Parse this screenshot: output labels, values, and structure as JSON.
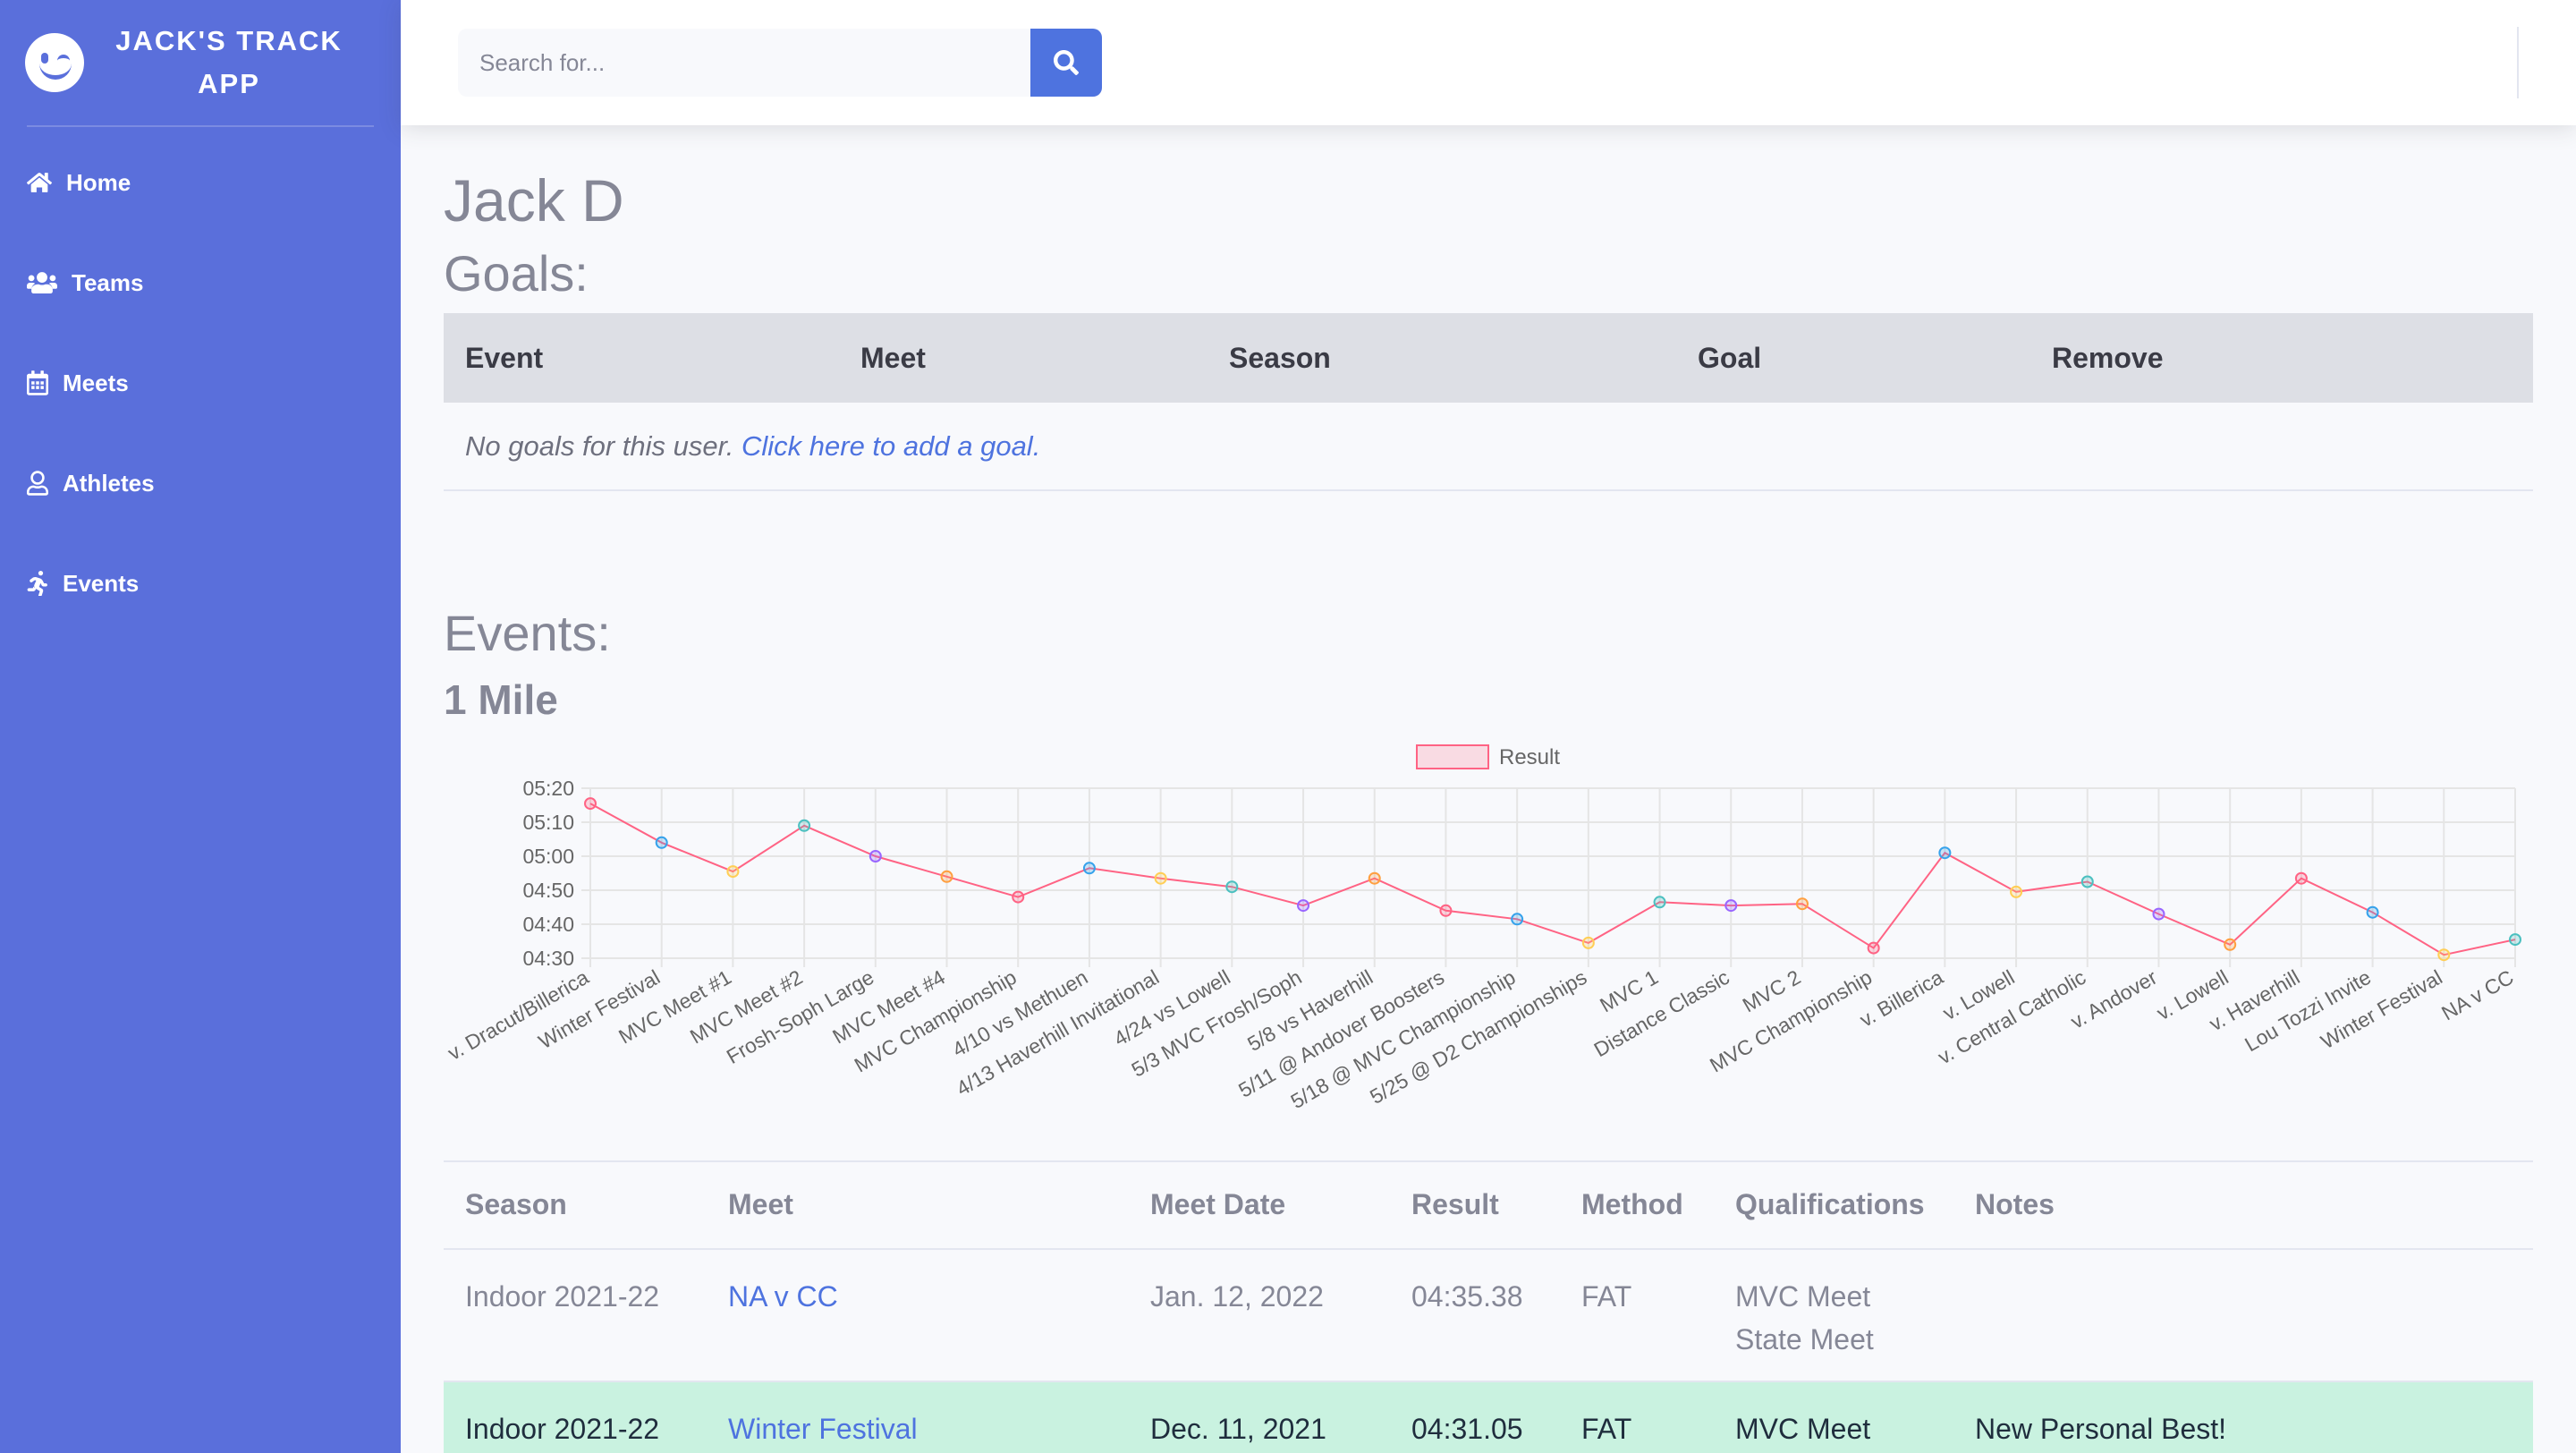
{
  "app": {
    "title": "JACK'S TRACK APP"
  },
  "sidebar": {
    "items": [
      {
        "label": "Home",
        "icon": "home-icon"
      },
      {
        "label": "Teams",
        "icon": "users-icon"
      },
      {
        "label": "Meets",
        "icon": "calendar-icon"
      },
      {
        "label": "Athletes",
        "icon": "user-icon"
      },
      {
        "label": "Events",
        "icon": "running-icon"
      }
    ]
  },
  "search": {
    "placeholder": "Search for..."
  },
  "athlete": {
    "name": "Jack D"
  },
  "goals": {
    "title": "Goals:",
    "columns": [
      "Event",
      "Meet",
      "Season",
      "Goal",
      "Remove"
    ],
    "empty_text": "No goals for this user.",
    "add_link": "Click here to add a goal."
  },
  "events": {
    "title": "Events:",
    "event_name": "1 Mile"
  },
  "chart_data": {
    "type": "line",
    "legend": "Result",
    "legend_position": "top-center",
    "grid": true,
    "y_ticks": [
      "04:30",
      "04:40",
      "04:50",
      "05:00",
      "05:10",
      "05:20"
    ],
    "ylim_seconds": [
      270,
      320
    ],
    "categories": [
      "v. Dracut/Billerica",
      "Winter Festival",
      "MVC Meet #1",
      "MVC Meet #2",
      "Frosh-Soph Large",
      "MVC Meet #4",
      "MVC Championship",
      "4/10 vs Methuen",
      "4/13 Haverhill Invitational",
      "4/24 vs Lowell",
      "5/3 MVC Frosh/Soph",
      "5/8 vs Haverhill",
      "5/11 @ Andover Boosters",
      "5/18 @ MVC Championship",
      "5/25 @ D2 Championships",
      "MVC 1",
      "Distance Classic",
      "MVC 2",
      "MVC Championship",
      "v. Billerica",
      "v. Lowell",
      "v. Central Catholic",
      "v. Andover",
      "v. Lowell",
      "v. Haverhill",
      "Lou Tozzi Invite",
      "Winter Festival",
      "NA v CC"
    ],
    "series": [
      {
        "name": "Result",
        "values_seconds": [
          315.5,
          304,
          295.5,
          309,
          300,
          294,
          288,
          296.5,
          293.5,
          291,
          285.5,
          293.5,
          284,
          281.5,
          274.5,
          286.5,
          285.5,
          286,
          273,
          301,
          289.5,
          292.5,
          283,
          274,
          293.5,
          283.5,
          271,
          275.5
        ]
      }
    ],
    "point_colors": [
      "#ff6384",
      "#36a2eb",
      "#ffce56",
      "#4bc0c0",
      "#9966ff",
      "#ff9f40"
    ],
    "line_color": "#ff6384"
  },
  "results": {
    "columns": [
      "Season",
      "Meet",
      "Meet Date",
      "Result",
      "Method",
      "Qualifications",
      "Notes"
    ],
    "rows": [
      {
        "season": "Indoor 2021-22",
        "meet": "NA v CC",
        "date": "Jan. 12, 2022",
        "result": "04:35.38",
        "method": "FAT",
        "qual1": "MVC Meet",
        "qual2": "State Meet",
        "notes": ""
      },
      {
        "season": "Indoor 2021-22",
        "meet": "Winter Festival",
        "date": "Dec. 11, 2021",
        "result": "04:31.05",
        "method": "FAT",
        "qual1": "MVC Meet",
        "qual2": "",
        "notes": "New Personal Best!"
      }
    ]
  }
}
